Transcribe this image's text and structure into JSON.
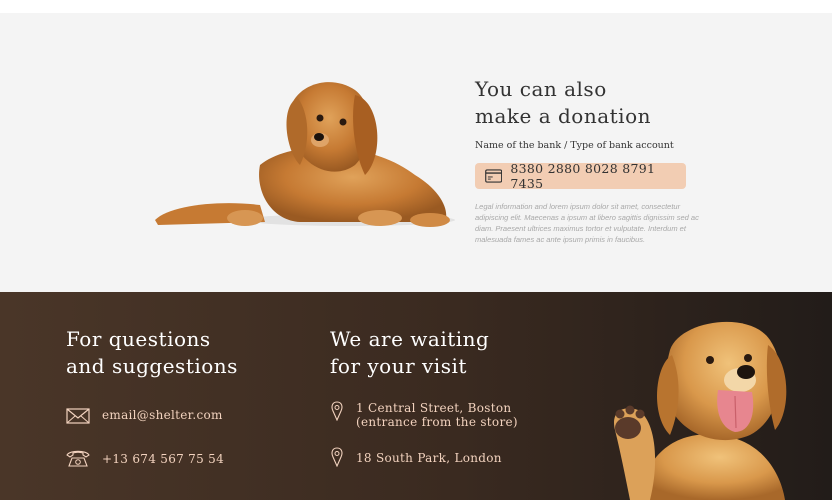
{
  "donation": {
    "title_line1": "You can also",
    "title_line2": "make a donation",
    "bank_label": "Name of the bank / Type of bank account",
    "bank_number": "8380 2880 8028 8791 7435",
    "card_icon": "credit-card-icon",
    "legal_text": "Legal information and lorem ipsum dolor sit amet, consectetur adipiscing elit. Maecenas a ipsum at libero sagittis dignissim sed ac diam. Praesent ultrices maximus tortor et vulputate. Interdum et malesuada fames ac ante ipsum primis in faucibus.",
    "image": "lying-puppy-photo"
  },
  "contacts": {
    "questions_title_line1": "For questions",
    "questions_title_line2": "and suggestions",
    "email": "email@shelter.com",
    "phone": "+13 674 567 75 54",
    "visit_title_line1": "We are waiting",
    "visit_title_line2": "for your visit",
    "address1_line1": "1 Central Street, Boston",
    "address1_line2": "(entrance from the store)",
    "address2": "18 South Park, London",
    "icons": {
      "email": "envelope-icon",
      "phone": "telephone-icon",
      "location": "map-pin-icon"
    },
    "image": "waving-puppy-photo"
  },
  "colors": {
    "donation_bg": "#f4f4f4",
    "bank_box": "#f2cdb3",
    "footer_bg_start": "#4a3628",
    "footer_bg_end": "#221c19",
    "accent_text": "#f3d3bf"
  }
}
